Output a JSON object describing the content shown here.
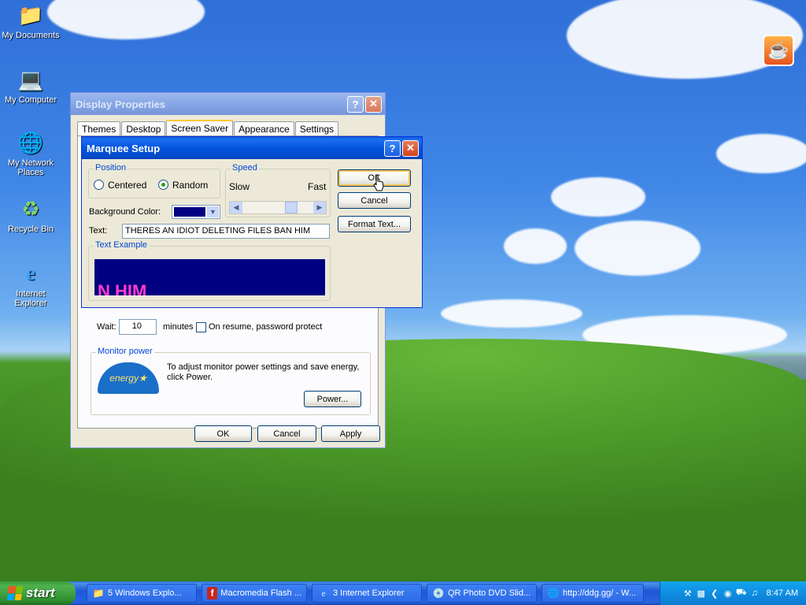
{
  "desktop": {
    "icons": [
      {
        "label": "My Documents"
      },
      {
        "label": "My Computer"
      },
      {
        "label": "My Network Places"
      },
      {
        "label": "Recycle Bin"
      },
      {
        "label": "Internet Explorer"
      }
    ]
  },
  "display_properties": {
    "title": "Display Properties",
    "tabs": [
      "Themes",
      "Desktop",
      "Screen Saver",
      "Appearance",
      "Settings"
    ],
    "active_tab": "Screen Saver",
    "wait_label": "Wait:",
    "wait_value": "10",
    "minutes_label": "minutes",
    "password_label": "On resume, password protect",
    "monitor_power": {
      "group_label": "Monitor power",
      "description": "To adjust monitor power settings and save energy, click Power.",
      "power_button": "Power...",
      "energy_logo_text": "energy"
    },
    "ok_button": "OK",
    "cancel_button": "Cancel",
    "apply_button": "Apply"
  },
  "marquee_setup": {
    "title": "Marquee Setup",
    "position_group": "Position",
    "centered_label": "Centered",
    "random_label": "Random",
    "selected_position": "Random",
    "speed_group": "Speed",
    "slow_label": "Slow",
    "fast_label": "Fast",
    "background_color_label": "Background Color:",
    "background_color": "#000080",
    "text_label": "Text:",
    "text_value": "THERES AN IDIOT DELETING FILES BAN HIM",
    "text_example_group": "Text Example",
    "preview_text": "N HIM",
    "ok_button": "OK",
    "cancel_button": "Cancel",
    "format_text_button": "Format Text..."
  },
  "taskbar": {
    "start_label": "start",
    "tasks": [
      {
        "label": "5 Windows Explo...",
        "icon": "folder-icon"
      },
      {
        "label": "Macromedia Flash ...",
        "icon": "flash-icon"
      },
      {
        "label": "3 Internet Explorer",
        "icon": "ie-icon"
      },
      {
        "label": "QR Photo DVD Slid...",
        "icon": "dvd-icon"
      },
      {
        "label": "http://ddg.gg/ - W...",
        "icon": "web-icon"
      }
    ],
    "clock": "8:47 AM"
  }
}
